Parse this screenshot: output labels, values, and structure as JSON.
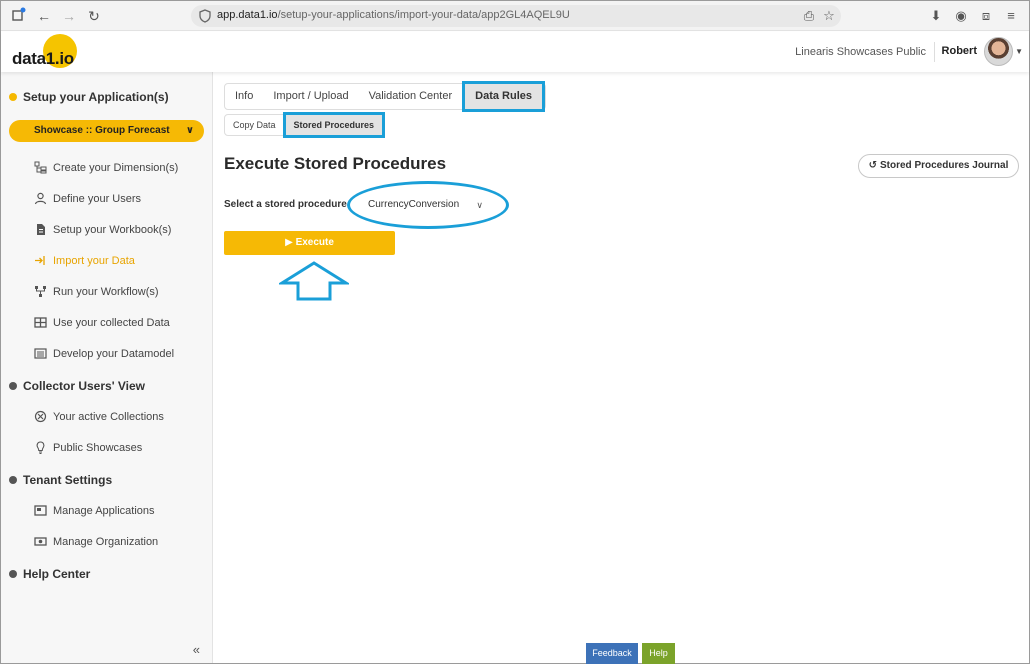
{
  "browser": {
    "url_domain": "app.data1.io",
    "url_path": "/setup-your-applications/import-your-data/app2GL4AQEL9U"
  },
  "header": {
    "logo": "data1.io",
    "tenant": "Linearis Showcases Public",
    "user": "Robert",
    "accent_color": "#f5c400"
  },
  "sidebar": {
    "sections": [
      {
        "label": "Setup your Application(s)"
      },
      {
        "label": "Collector Users' View"
      },
      {
        "label": "Tenant Settings"
      },
      {
        "label": "Help Center"
      }
    ],
    "showcase": "Showcase :: Group Forecast",
    "setup_items": [
      {
        "label": "Create your Dimension(s)",
        "icon": "dimension-icon"
      },
      {
        "label": "Define your Users",
        "icon": "user-icon"
      },
      {
        "label": "Setup your Workbook(s)",
        "icon": "file-icon"
      },
      {
        "label": "Import your Data",
        "icon": "import-icon"
      },
      {
        "label": "Run your Workflow(s)",
        "icon": "workflow-icon"
      },
      {
        "label": "Use your collected Data",
        "icon": "table-icon"
      },
      {
        "label": "Develop your Datamodel",
        "icon": "datamodel-icon"
      }
    ],
    "collector_items": [
      {
        "label": "Your active Collections",
        "icon": "collection-icon"
      },
      {
        "label": "Public Showcases",
        "icon": "bulb-icon"
      }
    ],
    "tenant_items": [
      {
        "label": "Manage Applications",
        "icon": "apps-icon"
      },
      {
        "label": "Manage Organization",
        "icon": "org-icon"
      }
    ],
    "collapse_glyph": "«"
  },
  "tabs": [
    "Info",
    "Import / Upload",
    "Validation Center",
    "Data Rules"
  ],
  "subtabs": [
    "Copy Data",
    "Stored Procedures"
  ],
  "page": {
    "title": "Execute Stored Procedures",
    "journal_button": "Stored Procedures Journal",
    "select_label": "Select a stored procedure",
    "select_value": "CurrencyConversion",
    "execute_label": "Execute"
  },
  "footer": {
    "feedback": "Feedback",
    "help": "Help"
  },
  "colors": {
    "highlight": "#1a9fd8",
    "primary_button": "#f6b905",
    "feedback": "#3d72b8",
    "help": "#7ba32a"
  }
}
